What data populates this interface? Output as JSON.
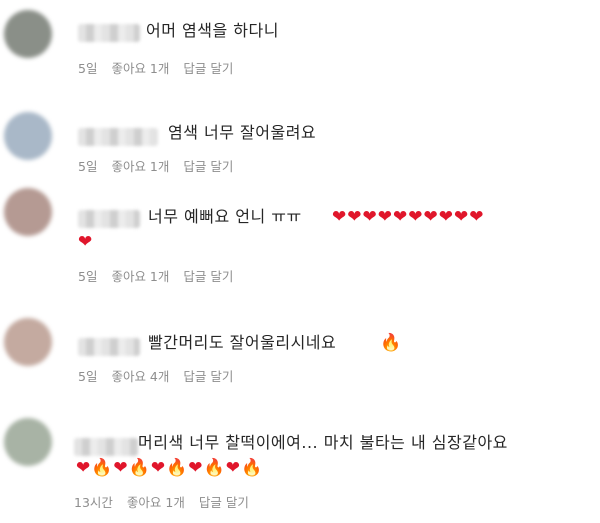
{
  "comments": [
    {
      "avatar_color": "#8a8f88",
      "text": "어머 염색을 하다니",
      "emojis": [],
      "time": "5일",
      "likes": "좋아요 1개",
      "reply": "답글 달기"
    },
    {
      "avatar_color": "#a9b8c8",
      "text": "염색 너무 잘어울려요",
      "emojis": [],
      "time": "5일",
      "likes": "좋아요 1개",
      "reply": "답글 달기"
    },
    {
      "avatar_color": "#b59a93",
      "text": "너무 예뻐요 언니 ㅠㅠ",
      "emojis": [
        "❤",
        "❤",
        "❤",
        "❤",
        "❤",
        "❤",
        "❤",
        "❤",
        "❤",
        "❤",
        "❤"
      ],
      "time": "5일",
      "likes": "좋아요 1개",
      "reply": "답글 달기"
    },
    {
      "avatar_color": "#c4aaa0",
      "text": "빨간머리도 잘어울리시네요",
      "emojis": [
        "🔥"
      ],
      "time": "5일",
      "likes": "좋아요 4개",
      "reply": "답글 달기"
    },
    {
      "avatar_color": "#a8b3a5",
      "text": "머리색 너무 찰떡이에여... 마치 불타는 내 심장같아요",
      "emojis": [
        "❤",
        "🔥",
        "❤",
        "🔥",
        "❤",
        "🔥",
        "❤",
        "🔥",
        "❤",
        "🔥"
      ],
      "time": "13시간",
      "likes": "좋아요 1개",
      "reply": "답글 달기"
    }
  ]
}
